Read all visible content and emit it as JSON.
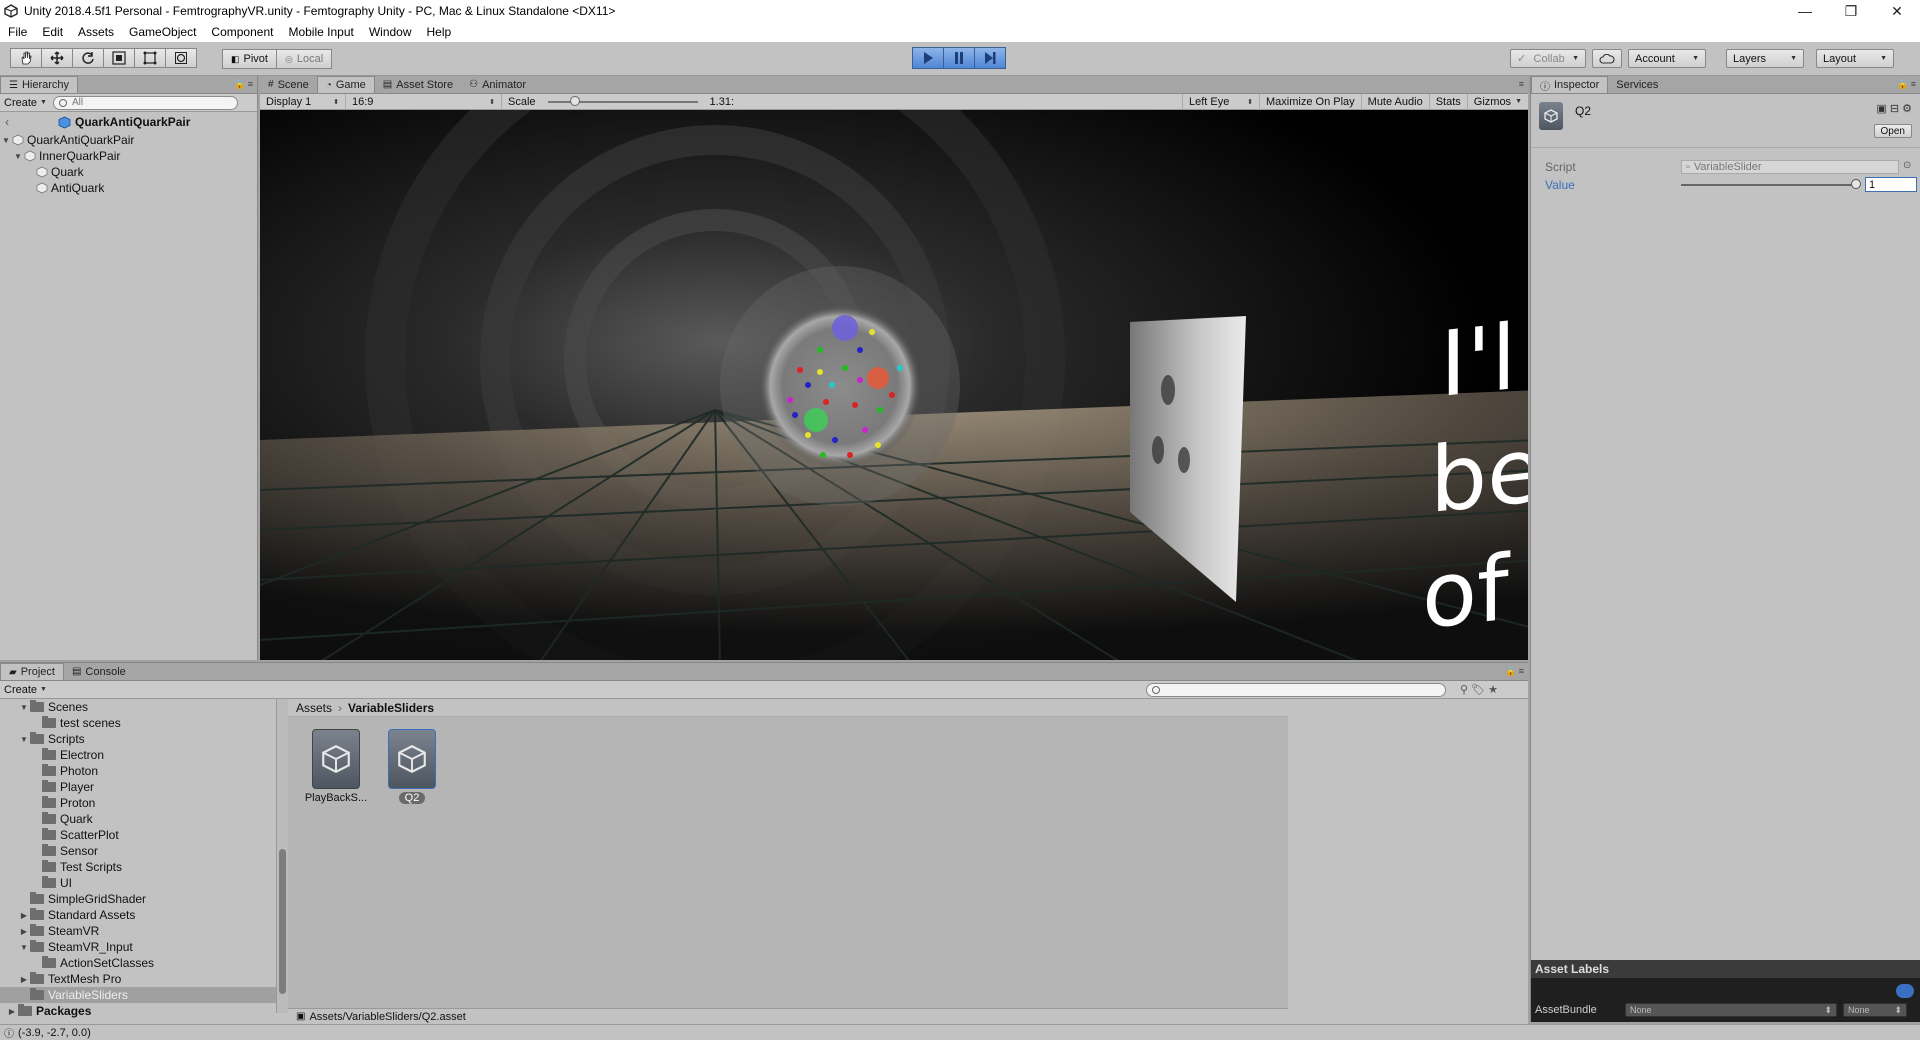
{
  "window": {
    "title": "Unity 2018.4.5f1 Personal - FemtrographyVR.unity - Femtography Unity - PC, Mac & Linux Standalone <DX11>",
    "controls": [
      "—",
      "❐",
      "✕"
    ]
  },
  "menu": [
    "File",
    "Edit",
    "Assets",
    "GameObject",
    "Component",
    "Mobile Input",
    "Window",
    "Help"
  ],
  "toolbar": {
    "pivot": "Pivot",
    "local": "Local",
    "collab": "Collab",
    "account": "Account",
    "layers": "Layers",
    "layout": "Layout"
  },
  "hierarchy": {
    "tab": "Hierarchy",
    "create": "Create",
    "search_placeholder": "All",
    "scene": "QuarkAntiQuarkPair",
    "items": [
      "QuarkAntiQuarkPair",
      "InnerQuarkPair",
      "Quark",
      "AntiQuark"
    ]
  },
  "center_tabs": [
    "Scene",
    "Game",
    "Asset Store",
    "Animator"
  ],
  "game_toolbar": {
    "display": "Display 1",
    "aspect": "16:9",
    "scale_label": "Scale",
    "scale_value": "1.31:",
    "eye": "Left Eye",
    "maximize": "Maximize On Play",
    "mute": "Mute Audio",
    "stats": "Stats",
    "gizmos": "Gizmos"
  },
  "game_view": {
    "text_lines": [
      "I'l",
      "be",
      "of"
    ]
  },
  "inspector": {
    "tabs": [
      "Inspector",
      "Services"
    ],
    "asset_name": "Q2",
    "open": "Open",
    "script_label": "Script",
    "script_value": "VariableSlider",
    "value_label": "Value",
    "value": "1",
    "asset_labels": "Asset Labels",
    "asset_bundle_label": "AssetBundle",
    "asset_bundle_value": "None",
    "asset_bundle_variant": "None"
  },
  "bottom_tabs": [
    "Project",
    "Console"
  ],
  "project": {
    "create": "Create",
    "breadcrumb": [
      "Assets",
      "VariableSliders"
    ],
    "tree": [
      {
        "label": "Scenes",
        "depth": 1,
        "expanded": true
      },
      {
        "label": "test scenes",
        "depth": 2
      },
      {
        "label": "Scripts",
        "depth": 1,
        "expanded": true
      },
      {
        "label": "Electron",
        "depth": 2
      },
      {
        "label": "Photon",
        "depth": 2
      },
      {
        "label": "Player",
        "depth": 2
      },
      {
        "label": "Proton",
        "depth": 2
      },
      {
        "label": "Quark",
        "depth": 2
      },
      {
        "label": "ScatterPlot",
        "depth": 2
      },
      {
        "label": "Sensor",
        "depth": 2
      },
      {
        "label": "Test Scripts",
        "depth": 2
      },
      {
        "label": "UI",
        "depth": 2
      },
      {
        "label": "SimpleGridShader",
        "depth": 1
      },
      {
        "label": "Standard Assets",
        "depth": 1,
        "collapsed": true
      },
      {
        "label": "SteamVR",
        "depth": 1,
        "collapsed": true
      },
      {
        "label": "SteamVR_Input",
        "depth": 1,
        "expanded": true
      },
      {
        "label": "ActionSetClasses",
        "depth": 2
      },
      {
        "label": "TextMesh Pro",
        "depth": 1,
        "collapsed": true
      },
      {
        "label": "VariableSliders",
        "depth": 1,
        "selected": true
      },
      {
        "label": "Packages",
        "depth": 0,
        "collapsed": true,
        "bold": true
      }
    ],
    "assets": [
      {
        "name": "PlayBackS...",
        "selected": false
      },
      {
        "name": "Q2",
        "selected": true
      }
    ],
    "path": "Assets/VariableSliders/Q2.asset"
  },
  "status": {
    "text": "(-3.9, -2.7, 0.0)"
  },
  "colors": {
    "accent": "#3c6fb8",
    "panel": "#c2c2c2",
    "play_blue": "#4f86d4"
  }
}
